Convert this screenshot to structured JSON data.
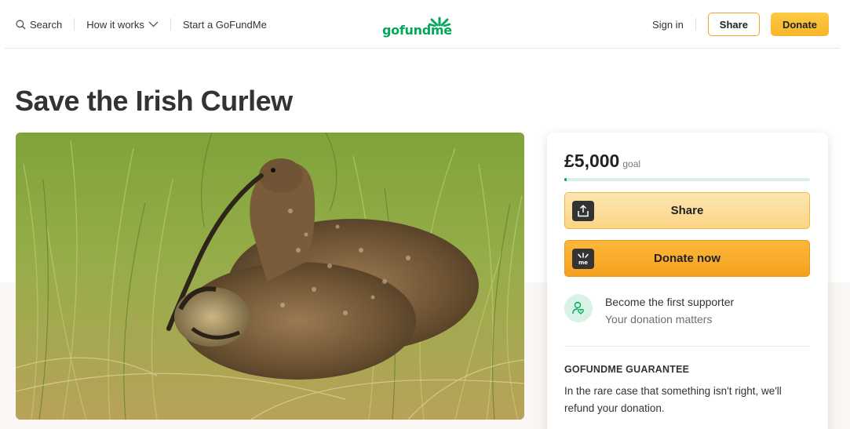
{
  "header": {
    "search_label": "Search",
    "how_it_works_label": "How it works",
    "start_label": "Start a GoFundMe",
    "logo_text": "gofundme",
    "signin_label": "Sign in",
    "share_label": "Share",
    "donate_label": "Donate"
  },
  "campaign": {
    "title": "Save the Irish Curlew",
    "photo_icon": "curlew-bird-photo"
  },
  "donation_card": {
    "goal_amount": "£5,000",
    "goal_label": "goal",
    "progress_fraction": 0.01,
    "share_button_label": "Share",
    "donate_button_label": "Donate now",
    "supporter_title": "Become the first supporter",
    "supporter_subtitle": "Your donation matters",
    "guarantee_title": "GOFUNDME GUARANTEE",
    "guarantee_text": "In the rare case that something isn't right, we'll refund your donation."
  },
  "colors": {
    "brand_green": "#02a95c",
    "donate_orange": "#f6a01f",
    "share_yellow": "#fbd486"
  }
}
